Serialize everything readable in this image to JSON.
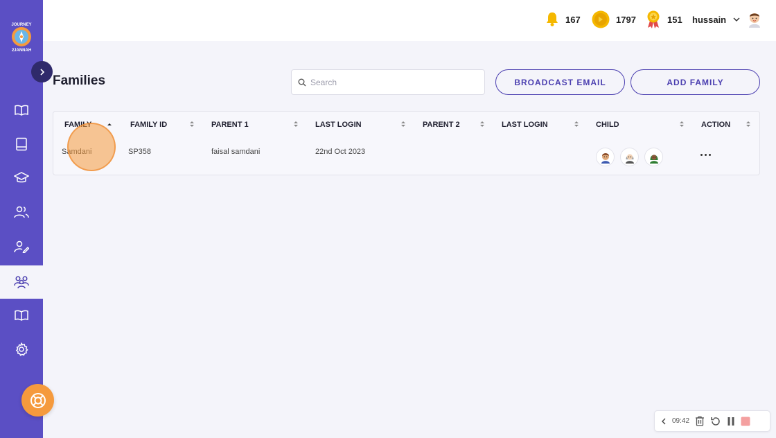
{
  "app": {
    "logo_text": "JOURNEY 2 JANNAH"
  },
  "colors": {
    "sidebar": "#5b4fc4",
    "accent": "#4b3fb0",
    "orange": "#f59a3d",
    "gold": "#f5b800"
  },
  "sidebar": {
    "items": [
      {
        "name": "book-open-icon",
        "active": false
      },
      {
        "name": "book-icon",
        "active": false
      },
      {
        "name": "graduation-cap-icon",
        "active": false
      },
      {
        "name": "users-icon",
        "active": false
      },
      {
        "name": "user-edit-icon",
        "active": false
      },
      {
        "name": "families-icon",
        "active": true
      },
      {
        "name": "book-open-icon",
        "active": false
      },
      {
        "name": "gear-icon",
        "active": false
      }
    ]
  },
  "topbar": {
    "notifications": "167",
    "coins": "1797",
    "awards": "151",
    "username": "hussain"
  },
  "page": {
    "title": "Families",
    "search_placeholder": "Search",
    "broadcast_label": "BROADCAST EMAIL",
    "add_family_label": "ADD FAMILY"
  },
  "table": {
    "columns": [
      "FAMILY",
      "FAMILY ID",
      "PARENT 1",
      "LAST LOGIN",
      "PARENT 2",
      "LAST LOGIN",
      "CHILD",
      "ACTION"
    ],
    "rows": [
      {
        "family": "Samdani",
        "family_id": "SP358",
        "parent1": "faisal samdani",
        "last_login1": "22nd Oct 2023",
        "parent2": "",
        "last_login2": ""
      }
    ]
  },
  "recorder": {
    "time": "09:42"
  }
}
